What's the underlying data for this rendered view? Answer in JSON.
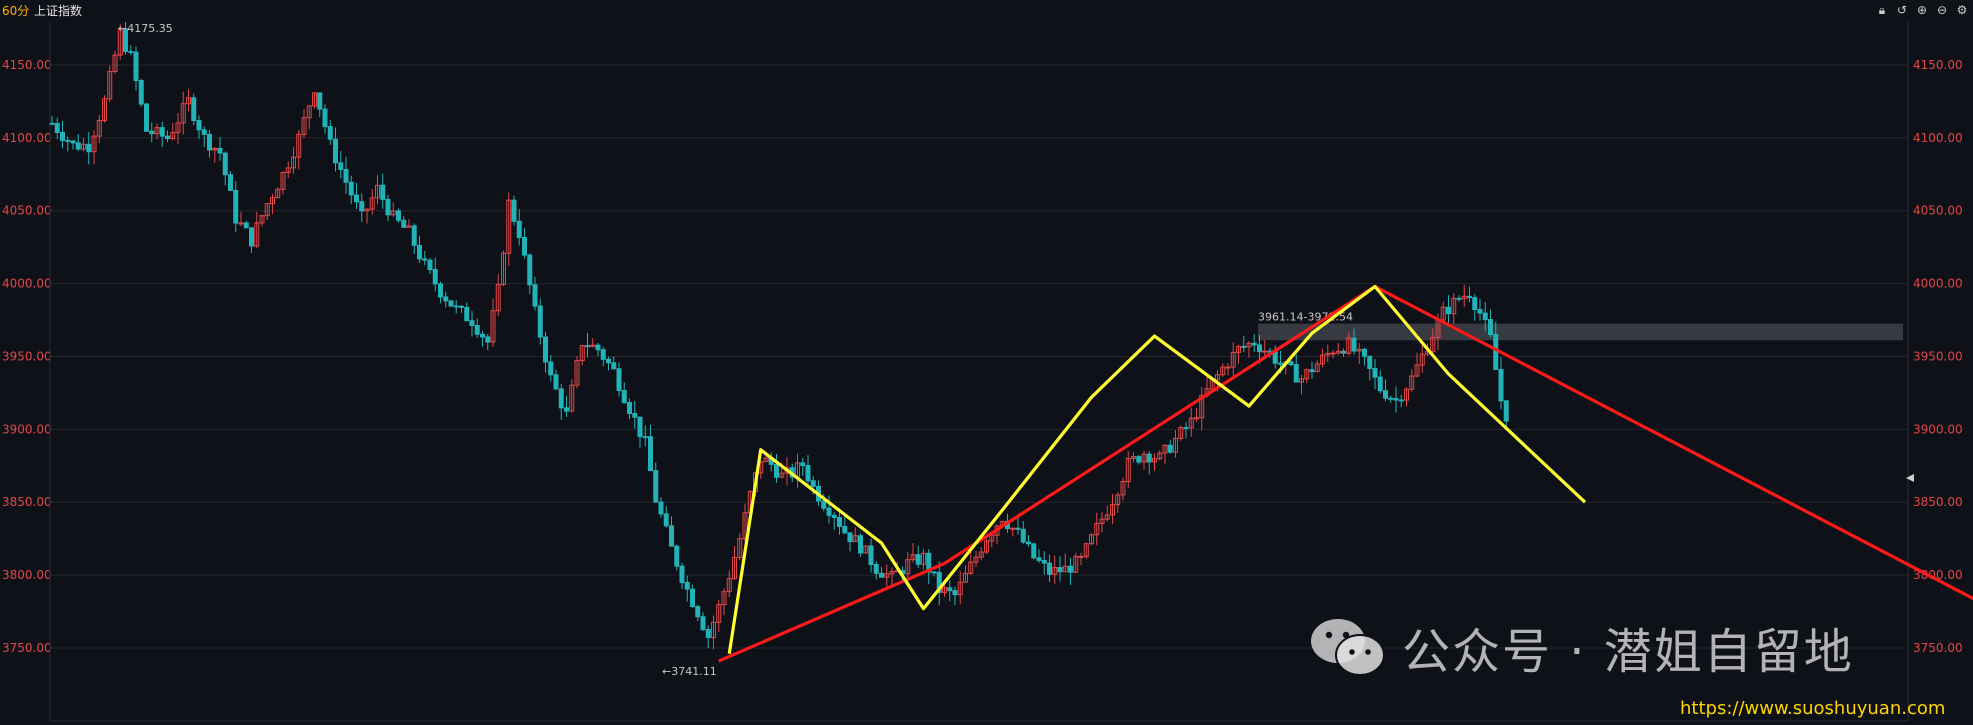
{
  "header": {
    "period": "60分",
    "title": "上证指数",
    "icons": [
      "lock-icon",
      "undo-icon",
      "zoom-in-icon",
      "zoom-out-icon",
      "settings-icon"
    ]
  },
  "chart_data": {
    "type": "candlestick",
    "y_axis": {
      "ticks": [
        3750,
        3800,
        3850,
        3900,
        3950,
        4000,
        4050,
        4100,
        4150
      ],
      "tick_labels": [
        "3750.00",
        "3800.00",
        "3850.00",
        "3900.00",
        "3950.00",
        "4000.00",
        "4050.00",
        "4100.00",
        "4150.00"
      ],
      "range": [
        3720,
        4200
      ],
      "both_sides": true,
      "grid": true
    },
    "colors": {
      "up": "#e04848",
      "down": "#22b3b8",
      "background": "#0f1118",
      "grid": "#23262e",
      "trend_red": "#ff1a1a",
      "wave_yellow": "#ffff33",
      "zone": "#5a5c63"
    },
    "bars": 139,
    "anchors": [
      [
        0,
        4110
      ],
      [
        4,
        4095
      ],
      [
        7,
        4095
      ],
      [
        10,
        4125
      ],
      [
        13,
        4172
      ],
      [
        15,
        4155
      ],
      [
        18,
        4105
      ],
      [
        22,
        4100
      ],
      [
        26,
        4125
      ],
      [
        29,
        4100
      ],
      [
        32,
        4090
      ],
      [
        35,
        4045
      ],
      [
        38,
        4030
      ],
      [
        41,
        4055
      ],
      [
        44,
        4075
      ],
      [
        47,
        4100
      ],
      [
        50,
        4135
      ],
      [
        53,
        4095
      ],
      [
        56,
        4070
      ],
      [
        59,
        4045
      ],
      [
        62,
        4065
      ],
      [
        65,
        4045
      ],
      [
        68,
        4035
      ],
      [
        71,
        4012
      ],
      [
        74,
        3995
      ],
      [
        77,
        3982
      ],
      [
        80,
        3975
      ],
      [
        83,
        3960
      ],
      [
        85,
        3995
      ],
      [
        87,
        4055
      ],
      [
        89,
        4035
      ],
      [
        92,
        3980
      ],
      [
        95,
        3935
      ],
      [
        98,
        3910
      ],
      [
        101,
        3960
      ],
      [
        104,
        3955
      ],
      [
        107,
        3940
      ],
      [
        110,
        3915
      ],
      [
        113,
        3890
      ],
      [
        115,
        3852
      ],
      [
        118,
        3818
      ],
      [
        121,
        3790
      ],
      [
        123,
        3775
      ],
      [
        125,
        3758
      ],
      [
        127,
        3778
      ],
      [
        129,
        3800
      ],
      [
        131,
        3825
      ],
      [
        133,
        3855
      ],
      [
        135,
        3880
      ],
      [
        137,
        3876
      ],
      [
        139,
        3868
      ],
      [
        141,
        3870
      ],
      [
        143,
        3876
      ],
      [
        145,
        3860
      ],
      [
        147,
        3850
      ],
      [
        149,
        3842
      ],
      [
        151,
        3830
      ],
      [
        154,
        3820
      ],
      [
        157,
        3805
      ],
      [
        160,
        3798
      ],
      [
        163,
        3808
      ],
      [
        166,
        3812
      ],
      [
        169,
        3790
      ],
      [
        172,
        3786
      ],
      [
        175,
        3806
      ],
      [
        178,
        3826
      ],
      [
        181,
        3840
      ],
      [
        184,
        3828
      ],
      [
        187,
        3812
      ],
      [
        190,
        3802
      ],
      [
        193,
        3804
      ],
      [
        196,
        3810
      ],
      [
        199,
        3832
      ],
      [
        202,
        3852
      ],
      [
        205,
        3876
      ],
      [
        208,
        3884
      ],
      [
        211,
        3880
      ],
      [
        214,
        3893
      ],
      [
        217,
        3905
      ],
      [
        220,
        3926
      ],
      [
        223,
        3942
      ],
      [
        226,
        3955
      ],
      [
        229,
        3960
      ],
      [
        232,
        3952
      ],
      [
        235,
        3942
      ],
      [
        238,
        3935
      ],
      [
        241,
        3945
      ],
      [
        244,
        3955
      ],
      [
        247,
        3958
      ],
      [
        250,
        3946
      ],
      [
        253,
        3928
      ],
      [
        256,
        3920
      ],
      [
        259,
        3935
      ],
      [
        262,
        3958
      ],
      [
        265,
        3980
      ],
      [
        268,
        3990
      ],
      [
        270,
        3994
      ],
      [
        272,
        3980
      ],
      [
        274,
        3962
      ],
      [
        276,
        3920
      ],
      [
        278,
        3900
      ],
      [
        280,
        3895
      ],
      [
        283,
        3898
      ],
      [
        286,
        3894
      ],
      [
        289,
        3900
      ],
      [
        292,
        3905
      ],
      [
        295,
        3888
      ],
      [
        298,
        3866
      ],
      [
        301,
        3860
      ],
      [
        304,
        3870
      ]
    ],
    "labels": [
      {
        "text": "←4175.35",
        "kind": "high",
        "value": 4175.35
      },
      {
        "text": "←3741.11",
        "kind": "low",
        "value": 3741.11
      },
      {
        "text": "3961.14-3972.54",
        "kind": "zone",
        "low": 3961.14,
        "high": 3972.54
      }
    ],
    "yellow_wave": [
      [
        129,
        3746
      ],
      [
        135,
        3886
      ],
      [
        158,
        3822
      ],
      [
        166,
        3777
      ],
      [
        180,
        3840
      ],
      [
        198,
        3922
      ],
      [
        210,
        3964
      ],
      [
        222,
        3932
      ],
      [
        228,
        3916
      ],
      [
        240,
        3966
      ],
      [
        252,
        3998
      ],
      [
        266,
        3938
      ],
      [
        292,
        3850
      ]
    ],
    "red_trend": [
      [
        127,
        3741
      ],
      [
        170,
        3808
      ],
      [
        252,
        3998
      ],
      [
        384,
        3750
      ]
    ]
  },
  "watermark": {
    "text": "公众号 · 潜姐自留地",
    "url": "https://www.suoshuyuan.com"
  }
}
